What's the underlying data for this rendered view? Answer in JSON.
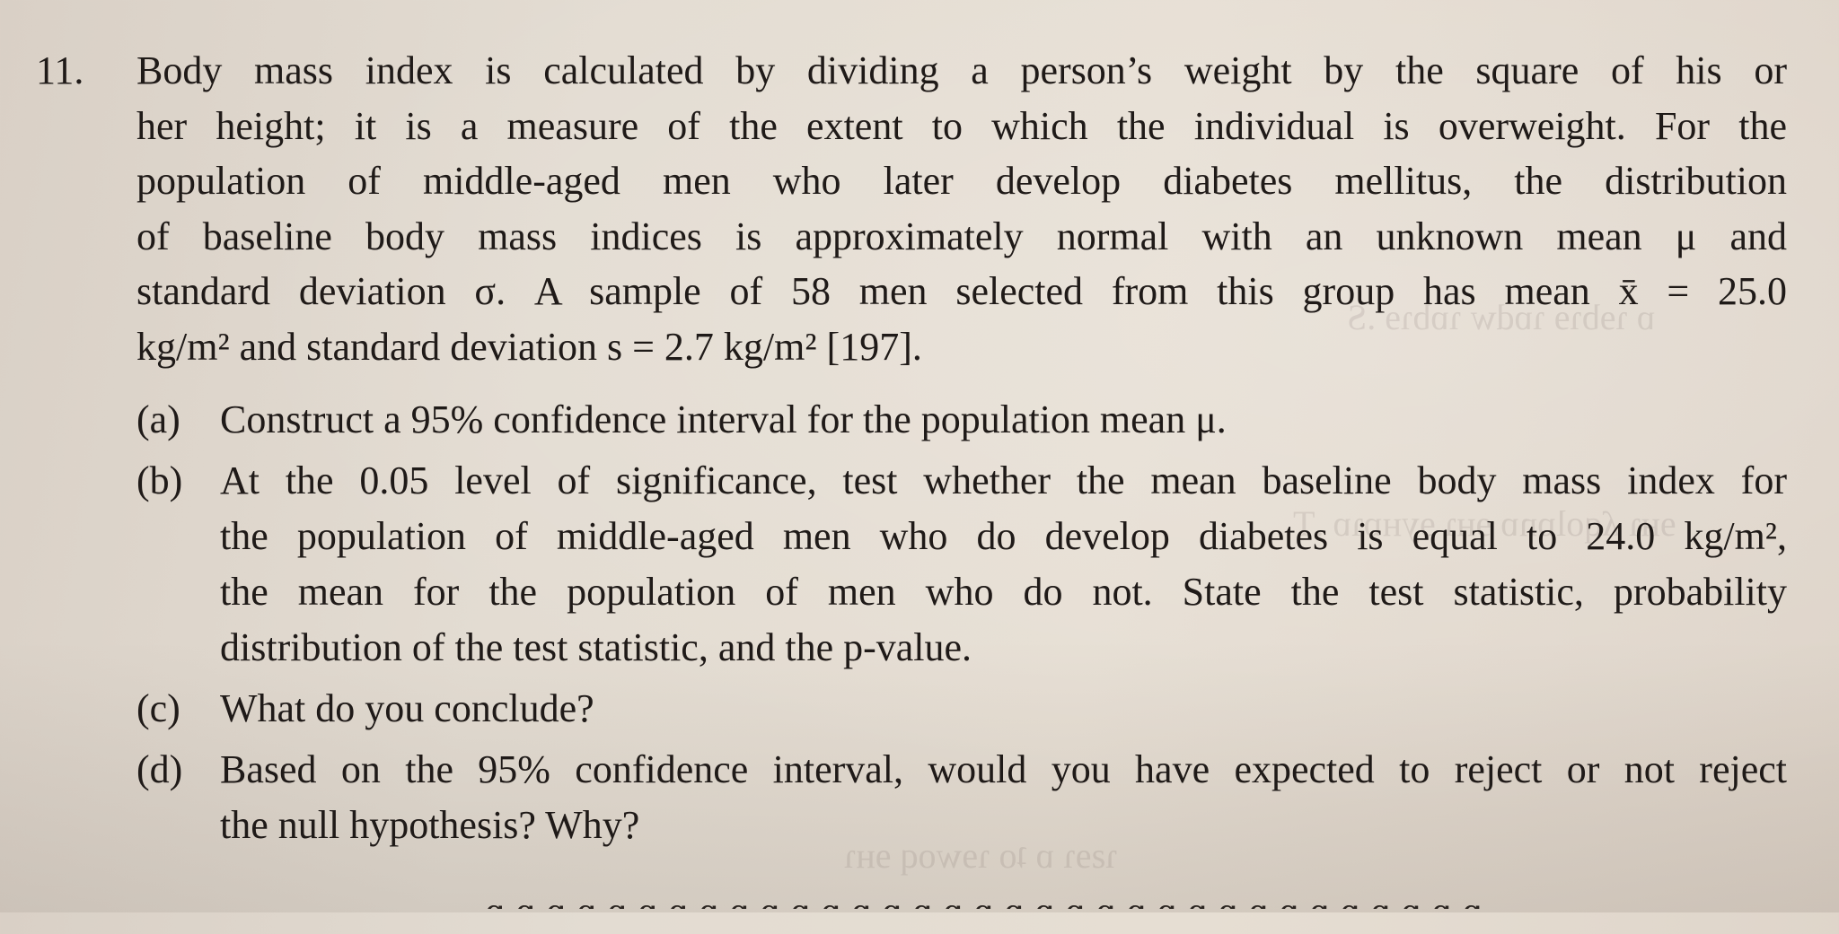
{
  "problem": {
    "number": "11.",
    "stem_lines": [
      "Body mass index is calculated by dividing a person’s weight by the square of his or",
      "her height; it is a measure of the extent to which the individual is overweight. For the",
      "population of middle-aged men who later develop diabetes mellitus, the distribution",
      "of baseline body mass indices is approximately normal with an unknown mean μ and",
      "standard deviation σ. A sample of 58 men selected from this group has mean x̄ = 25.0",
      "kg/m² and standard deviation s = 2.7 kg/m² [197]."
    ],
    "parts": [
      {
        "label": "(a)",
        "lines": [
          "Construct a 95% confidence interval for the population mean μ."
        ]
      },
      {
        "label": "(b)",
        "lines": [
          "At the 0.05 level of significance, test whether the mean baseline body mass index for",
          "the population of middle-aged men who do develop diabetes is equal to 24.0 kg/m²,",
          "the mean for the population of men who do not. State the test statistic, probability",
          "distribution of the test statistic, and the p-value."
        ]
      },
      {
        "label": "(c)",
        "lines": [
          "What do you conclude?"
        ]
      },
      {
        "label": "(d)",
        "lines": [
          "Based on the 95% confidence interval, would you have expected to reject or not reject",
          "the null hypothesis? Why?"
        ]
      }
    ]
  }
}
